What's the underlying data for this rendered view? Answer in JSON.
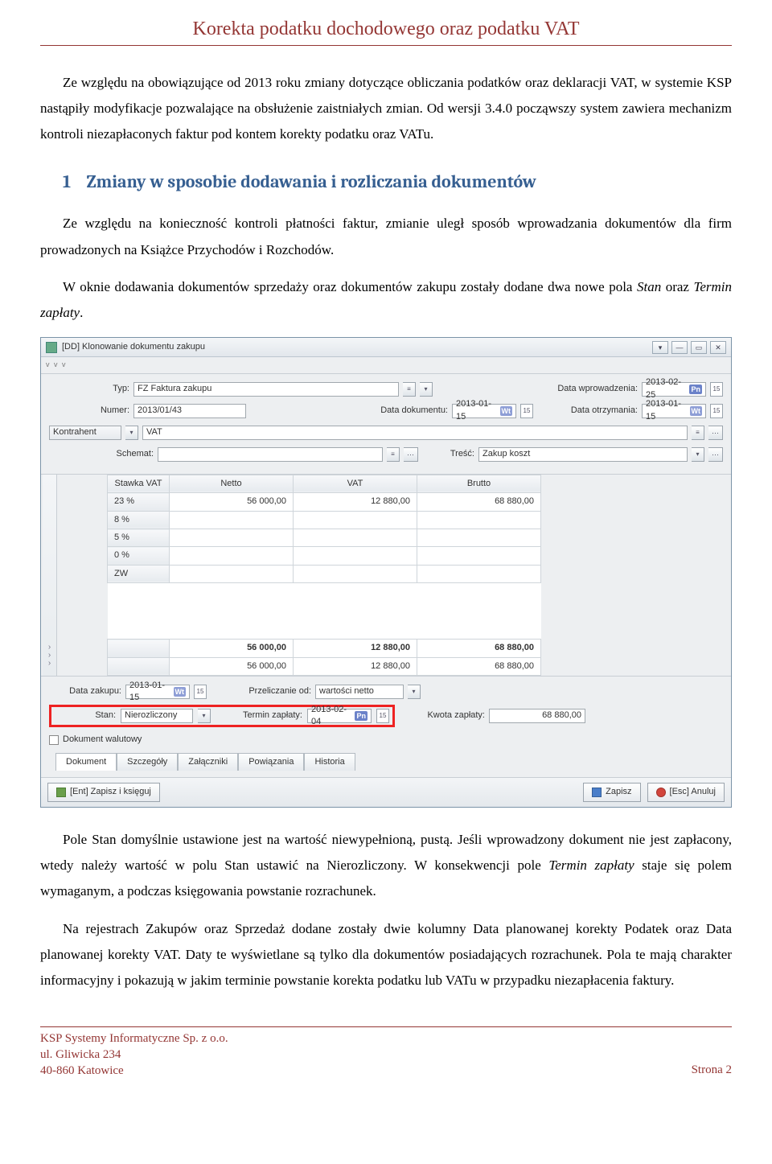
{
  "header": {
    "title": "Korekta podatku dochodowego oraz podatku VAT"
  },
  "para1": "Ze względu na obowiązujące od 2013 roku zmiany dotyczące obliczania podatków oraz deklaracji VAT, w systemie KSP nastąpiły modyfikacje pozwalające na obsłużenie zaistniałych zmian. Od wersji 3.4.0 począwszy system zawiera mechanizm kontroli niezapłaconych faktur pod kontem korekty podatku oraz VATu.",
  "section1": {
    "num": "1",
    "title": "Zmiany w sposobie dodawania i rozliczania dokumentów"
  },
  "para2": "Ze względu na konieczność kontroli płatności faktur, zmianie uległ sposób wprowadzania dokumentów dla firm prowadzonych na Książce Przychodów i Rozchodów.",
  "para3a": "W oknie dodawania dokumentów sprzedaży oraz dokumentów zakupu zostały dodane dwa nowe pola ",
  "para3b": "Stan",
  "para3c": " oraz ",
  "para3d": "Termin zapłaty",
  "para3e": ".",
  "app": {
    "title": "[DD] Klonowanie dokumentu zakupu",
    "typ_label": "Typ:",
    "typ_value": "FZ Faktura zakupu",
    "data_wprow_label": "Data wprowadzenia:",
    "data_wprow_value": "2013-02-25",
    "data_wprow_day": "Pn",
    "numer_label": "Numer:",
    "numer_value": "2013/01/43",
    "data_dok_label": "Data dokumentu:",
    "data_dok_value": "2013-01-15",
    "data_dok_day": "Wt",
    "data_otrz_label": "Data otrzymania:",
    "data_otrz_value": "2013-01-15",
    "data_otrz_day": "Wt",
    "kontrahent_label": "Kontrahent",
    "kontrahent_value": "VAT",
    "schemat_label": "Schemat:",
    "tresc_label": "Treść:",
    "tresc_value": "Zakup koszt",
    "columns": {
      "stawka": "Stawka VAT",
      "netto": "Netto",
      "vat": "VAT",
      "brutto": "Brutto"
    },
    "rows": [
      {
        "stawka": "23 %",
        "netto": "56 000,00",
        "vat": "12 880,00",
        "brutto": "68 880,00"
      },
      {
        "stawka": "8 %",
        "netto": "",
        "vat": "",
        "brutto": ""
      },
      {
        "stawka": "5 %",
        "netto": "",
        "vat": "",
        "brutto": ""
      },
      {
        "stawka": "0 %",
        "netto": "",
        "vat": "",
        "brutto": ""
      },
      {
        "stawka": "ZW",
        "netto": "",
        "vat": "",
        "brutto": ""
      }
    ],
    "totals_bold": {
      "netto": "56 000,00",
      "vat": "12 880,00",
      "brutto": "68 880,00"
    },
    "totals_plain": {
      "netto": "56 000,00",
      "vat": "12 880,00",
      "brutto": "68 880,00"
    },
    "data_zakupu_label": "Data zakupu:",
    "data_zakupu_value": "2013-01-15",
    "data_zakupu_day": "Wt",
    "przeliczanie_label": "Przeliczanie od:",
    "przeliczanie_value": "wartości netto",
    "stan_label": "Stan:",
    "stan_value": "Nierozliczony",
    "termin_label": "Termin zapłaty:",
    "termin_value": "2013-02-04",
    "termin_day": "Pn",
    "kwota_label": "Kwota zapłaty:",
    "kwota_value": "68 880,00",
    "walutowy_label": "Dokument walutowy",
    "tabs": {
      "dokument": "Dokument",
      "szczegoly": "Szczegóły",
      "zalaczniki": "Załączniki",
      "powiazania": "Powiązania",
      "historia": "Historia"
    },
    "btn_save_book": "[Ent] Zapisz i księguj",
    "btn_save": "Zapisz",
    "btn_cancel": "[Esc] Anuluj"
  },
  "para4a": "Pole ",
  "para4b": "Stan",
  "para4c": " domyślnie ustawione jest na wartość niewypełnioną, pustą. Jeśli wprowadzony dokument nie jest zapłacony, wtedy należy wartość w polu ",
  "para4d": "Stan",
  "para4e": " ustawić na ",
  "para4f": "Nierozliczony",
  "para4g": ". W konsekwencji pole ",
  "para4h": "Termin zapłaty",
  "para4i": " staje się polem wymaganym, a podczas księgowania powstanie rozrachunek.",
  "para5a": "Na rejestrach Zakupów oraz Sprzedaż dodane zostały dwie kolumny ",
  "para5b": "Data planowanej korekty Podatek",
  "para5c": " oraz ",
  "para5d": "Data planowanej korekty VAT",
  "para5e": ". Daty te wyświetlane są tylko dla dokumentów posiadających rozrachunek. Pola te mają charakter informacyjny i pokazują w jakim terminie powstanie korekta podatku lub VATu w przypadku niezapłacenia faktury.",
  "footer": {
    "line1": "KSP Systemy Informatyczne Sp. z o.o.",
    "line2": "ul. Gliwicka 234",
    "line3": "40-860 Katowice",
    "page": "Strona 2"
  }
}
